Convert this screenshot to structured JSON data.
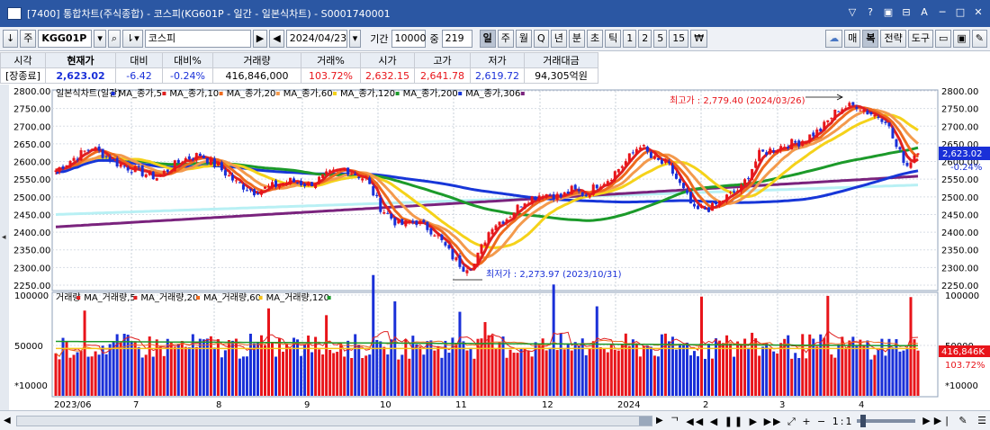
{
  "window": {
    "title": "[7400]  통합차트(주식종합) - 코스피(KG601P - 일간 - 일본식차트) - S0001740001",
    "controls": [
      "▽",
      "?",
      "▣",
      "⊟",
      "A",
      "─",
      "□",
      "✕"
    ]
  },
  "toolbar": {
    "code": "KGG01P",
    "name": "코스피",
    "date": "2024/04/23",
    "period_label": "기간",
    "period_value": "10000",
    "count_label": "중",
    "count_value": "219",
    "intervals": [
      "일",
      "주",
      "월",
      "Q",
      "년",
      "분",
      "초",
      "틱",
      "1",
      "2",
      "5",
      "15",
      "₩"
    ],
    "selected_interval": "일",
    "right_buttons": [
      "매",
      "복",
      "전략",
      "도구"
    ]
  },
  "quote": {
    "headers": [
      "시각",
      "현재가",
      "대비",
      "대비%",
      "거래량",
      "거래%",
      "시가",
      "고가",
      "저가",
      "거래대금"
    ],
    "values": [
      "[장종료]",
      "2,623.02",
      "-6.42",
      "-0.24%",
      "416,846,000",
      "103.72%",
      "2,632.15",
      "2,641.78",
      "2,619.72",
      "94,305억원"
    ]
  },
  "chart_data": {
    "type": "candlestick",
    "price_legend": [
      "일본식차트(일간)",
      "MA_종가,5",
      "MA_종가,10",
      "MA_종가,20",
      "MA_종가,60",
      "MA_종가,120",
      "MA_종가,200",
      "MA_종가,306"
    ],
    "volume_legend": [
      "거래량",
      "MA_거래량,5",
      "MA_거래량,20",
      "MA_거래량,60",
      "MA_거래량,120"
    ],
    "price_axis": {
      "min": 2250,
      "max": 2800,
      "ticks": [
        2800,
        2750,
        2700,
        2650,
        2600,
        2550,
        2500,
        2450,
        2400,
        2350,
        2300,
        2250
      ]
    },
    "volume_axis": {
      "ticks": [
        "100000",
        "50000"
      ],
      "unit": "*10000"
    },
    "x_labels": [
      "2023/06",
      "7",
      "8",
      "9",
      "10",
      "11",
      "12",
      "2024",
      "2",
      "3",
      "4"
    ],
    "current_price": "2,623.02",
    "current_change": "-0.24%",
    "current_volume": "416,846K",
    "current_volume_pct": "103.72%",
    "high_annotation": "최고가 : 2,779.40 (2024/03/26)",
    "low_annotation": "최저가 : 2,273.97 (2023/10/31)",
    "ma_colors": {
      "ma5": "#e02020",
      "ma10": "#ee6a1e",
      "ma20": "#f39a4d",
      "ma60": "#f5d21a",
      "ma120": "#1c9a2a",
      "ma200": "#1736d8",
      "ma306": "#7a237d",
      "ma_ext": "#b8f0f4"
    },
    "up_color": "#e8141a",
    "down_color": "#1a30d8",
    "close_anchors": [
      [
        0,
        2575
      ],
      [
        5,
        2610
      ],
      [
        10,
        2640
      ],
      [
        17,
        2595
      ],
      [
        22,
        2575
      ],
      [
        28,
        2555
      ],
      [
        35,
        2605
      ],
      [
        40,
        2620
      ],
      [
        45,
        2585
      ],
      [
        50,
        2540
      ],
      [
        55,
        2515
      ],
      [
        60,
        2530
      ],
      [
        65,
        2545
      ],
      [
        70,
        2535
      ],
      [
        75,
        2560
      ],
      [
        80,
        2580
      ],
      [
        86,
        2550
      ],
      [
        90,
        2470
      ],
      [
        95,
        2420
      ],
      [
        100,
        2430
      ],
      [
        105,
        2400
      ],
      [
        110,
        2330
      ],
      [
        113,
        2300
      ],
      [
        116,
        2310
      ],
      [
        119,
        2380
      ],
      [
        121,
        2420
      ],
      [
        125,
        2440
      ],
      [
        130,
        2490
      ],
      [
        135,
        2510
      ],
      [
        140,
        2500
      ],
      [
        143,
        2520
      ],
      [
        147,
        2505
      ],
      [
        150,
        2535
      ],
      [
        153,
        2550
      ],
      [
        158,
        2600
      ],
      [
        162,
        2650
      ],
      [
        165,
        2610
      ],
      [
        170,
        2585
      ],
      [
        175,
        2500
      ],
      [
        177,
        2460
      ],
      [
        182,
        2470
      ],
      [
        186,
        2500
      ],
      [
        190,
        2525
      ],
      [
        195,
        2620
      ],
      [
        200,
        2640
      ],
      [
        203,
        2650
      ],
      [
        206,
        2655
      ],
      [
        212,
        2690
      ],
      [
        217,
        2750
      ],
      [
        222,
        2760
      ],
      [
        225,
        2740
      ],
      [
        230,
        2720
      ],
      [
        233,
        2640
      ],
      [
        236,
        2590
      ],
      [
        238,
        2620
      ],
      [
        239,
        2623
      ]
    ],
    "volume_series_ma_levels": {
      "ma5": 52000,
      "ma20": 48000,
      "ma60": 47000,
      "ma120": 54000
    }
  }
}
